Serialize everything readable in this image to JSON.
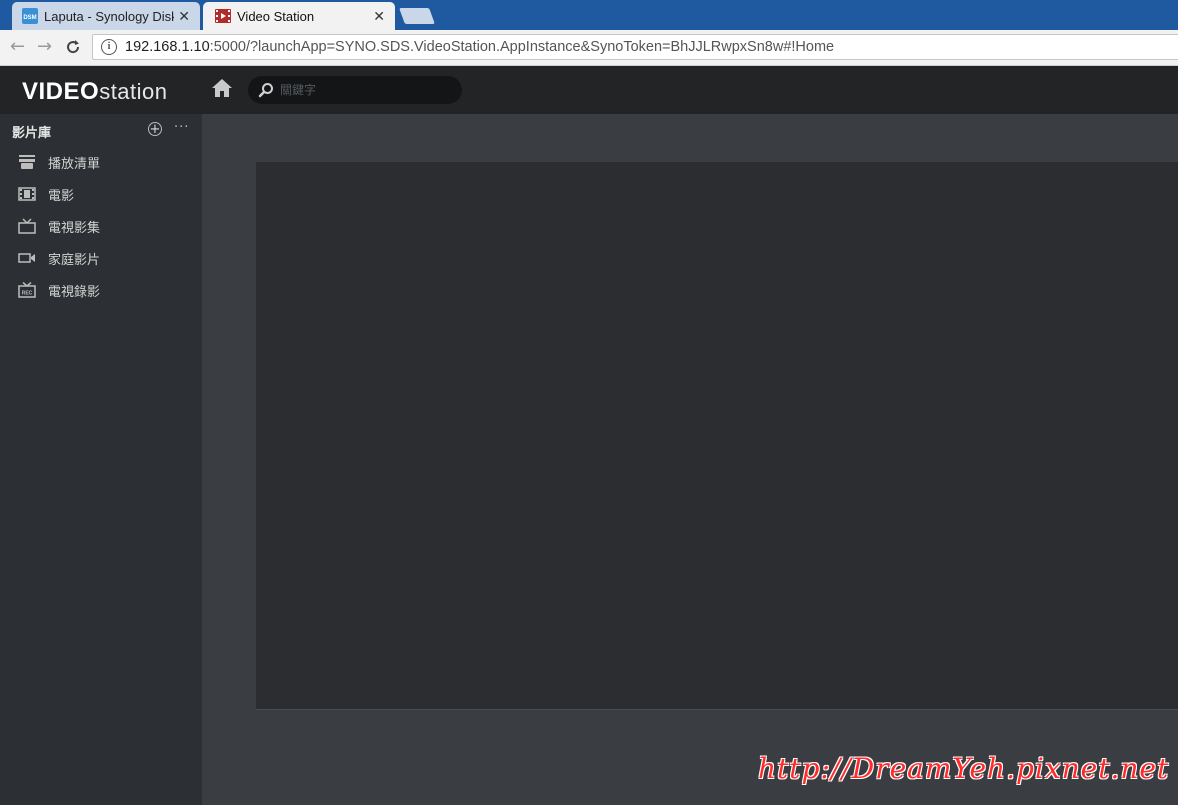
{
  "browser": {
    "tabs": [
      {
        "title": "Laputa - Synology Disk",
        "icon": "dsm-icon",
        "active": false
      },
      {
        "title": "Video Station",
        "icon": "video-station-icon",
        "active": true
      }
    ],
    "close_glyph": "✕",
    "url_host": "192.168.1.10",
    "url_rest": ":5000/?launchApp=SYNO.SDS.VideoStation.AppInstance&SynoToken=BhJJLRwpxSn8w#!Home",
    "back_glyph": "←",
    "forward_glyph": "→",
    "reload_glyph": "C",
    "info_glyph": "i"
  },
  "app": {
    "logo_strong": "VIDEO",
    "logo_light": "station",
    "search_placeholder": "關鍵字"
  },
  "sidebar": {
    "title": "影片庫",
    "add_glyph": "+",
    "more_glyph": "···",
    "items": [
      {
        "label": "播放清單",
        "icon": "playlist-icon"
      },
      {
        "label": "電影",
        "icon": "movie-film-icon"
      },
      {
        "label": "電視影集",
        "icon": "tv-icon"
      },
      {
        "label": "家庭影片",
        "icon": "camera-icon"
      },
      {
        "label": "電視錄影",
        "icon": "tv-recording-icon"
      }
    ]
  },
  "watermark": "http://DreamYeh.pixnet.net",
  "colors": {
    "tabstrip": "#1f5aa0",
    "app_header": "#222426",
    "sidebar": "#2c2f33",
    "main": "#3a3d41",
    "panel": "#2b2d31",
    "watermark": "#ff2b2b"
  }
}
